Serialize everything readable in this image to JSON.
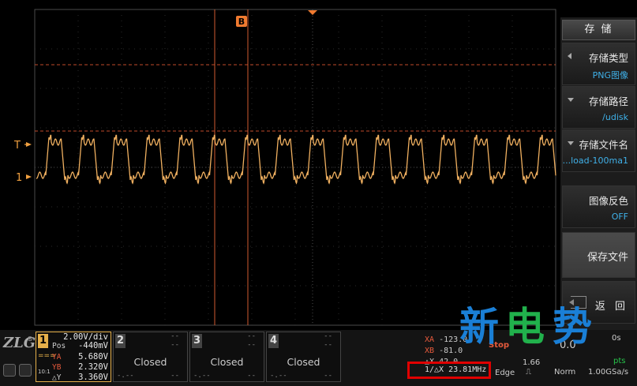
{
  "scope": {
    "cursor_b_label": "B",
    "trigger_marker": "T",
    "channel1_marker": "1",
    "colors": {
      "trace": "#f0b060",
      "cursor": "#e06030",
      "grid": "#3a3a3a",
      "trigger_line": "#d05030"
    }
  },
  "menu": {
    "title": "存 储",
    "items": [
      {
        "label": "存储类型",
        "value": "PNG图像",
        "arrow": "left"
      },
      {
        "label": "存储路径",
        "value": "/udisk",
        "arrow": "down"
      },
      {
        "label": "存储文件名",
        "value": "...load-100ma1",
        "arrow": "down"
      },
      {
        "label": "图像反色",
        "value": "OFF",
        "arrow": ""
      }
    ],
    "save_label": "保存文件",
    "back_label": "返 回"
  },
  "bottom": {
    "logo": "ZLG",
    "ch1": {
      "num": "1",
      "vdiv": "2.00V/div",
      "pos_key": "Pos",
      "pos_val": "-440mV",
      "ya_key": "YA",
      "ya_val": "5.680V",
      "yb_key": "YB",
      "yb_val": "2.320V",
      "dy_key": "△Y",
      "dy_val": "3.360V",
      "dash1": "==="
    },
    "ch2": {
      "num": "2",
      "status": "Closed",
      "d1": "--",
      "d2": "--",
      "d3": "-.--",
      "d4": "--"
    },
    "ch3": {
      "num": "3",
      "status": "Closed",
      "d1": "--",
      "d2": "--",
      "d3": "-.--",
      "d4": "--"
    },
    "ch4": {
      "num": "4",
      "status": "Closed",
      "d1": "--",
      "d2": "--",
      "d3": "-.--",
      "d4": "--"
    },
    "cursors": {
      "xa_key": "XA",
      "xa_val": "-123.0",
      "xb_key": "XB",
      "xb_val": "-81.0",
      "dx_key": "△X",
      "dx_val": "42.0",
      "freq": "1/△X  23.81MHz"
    },
    "trigger": {
      "value": "1.66",
      "type": "Edge",
      "stop": "Stop"
    },
    "acq": {
      "time": "0.0",
      "mode": "Norm",
      "rate": "1.00GSa/s",
      "pts": "pts",
      "s": "0s"
    }
  },
  "watermark": {
    "c1": "新",
    "c2": "电",
    "c3": "势"
  }
}
